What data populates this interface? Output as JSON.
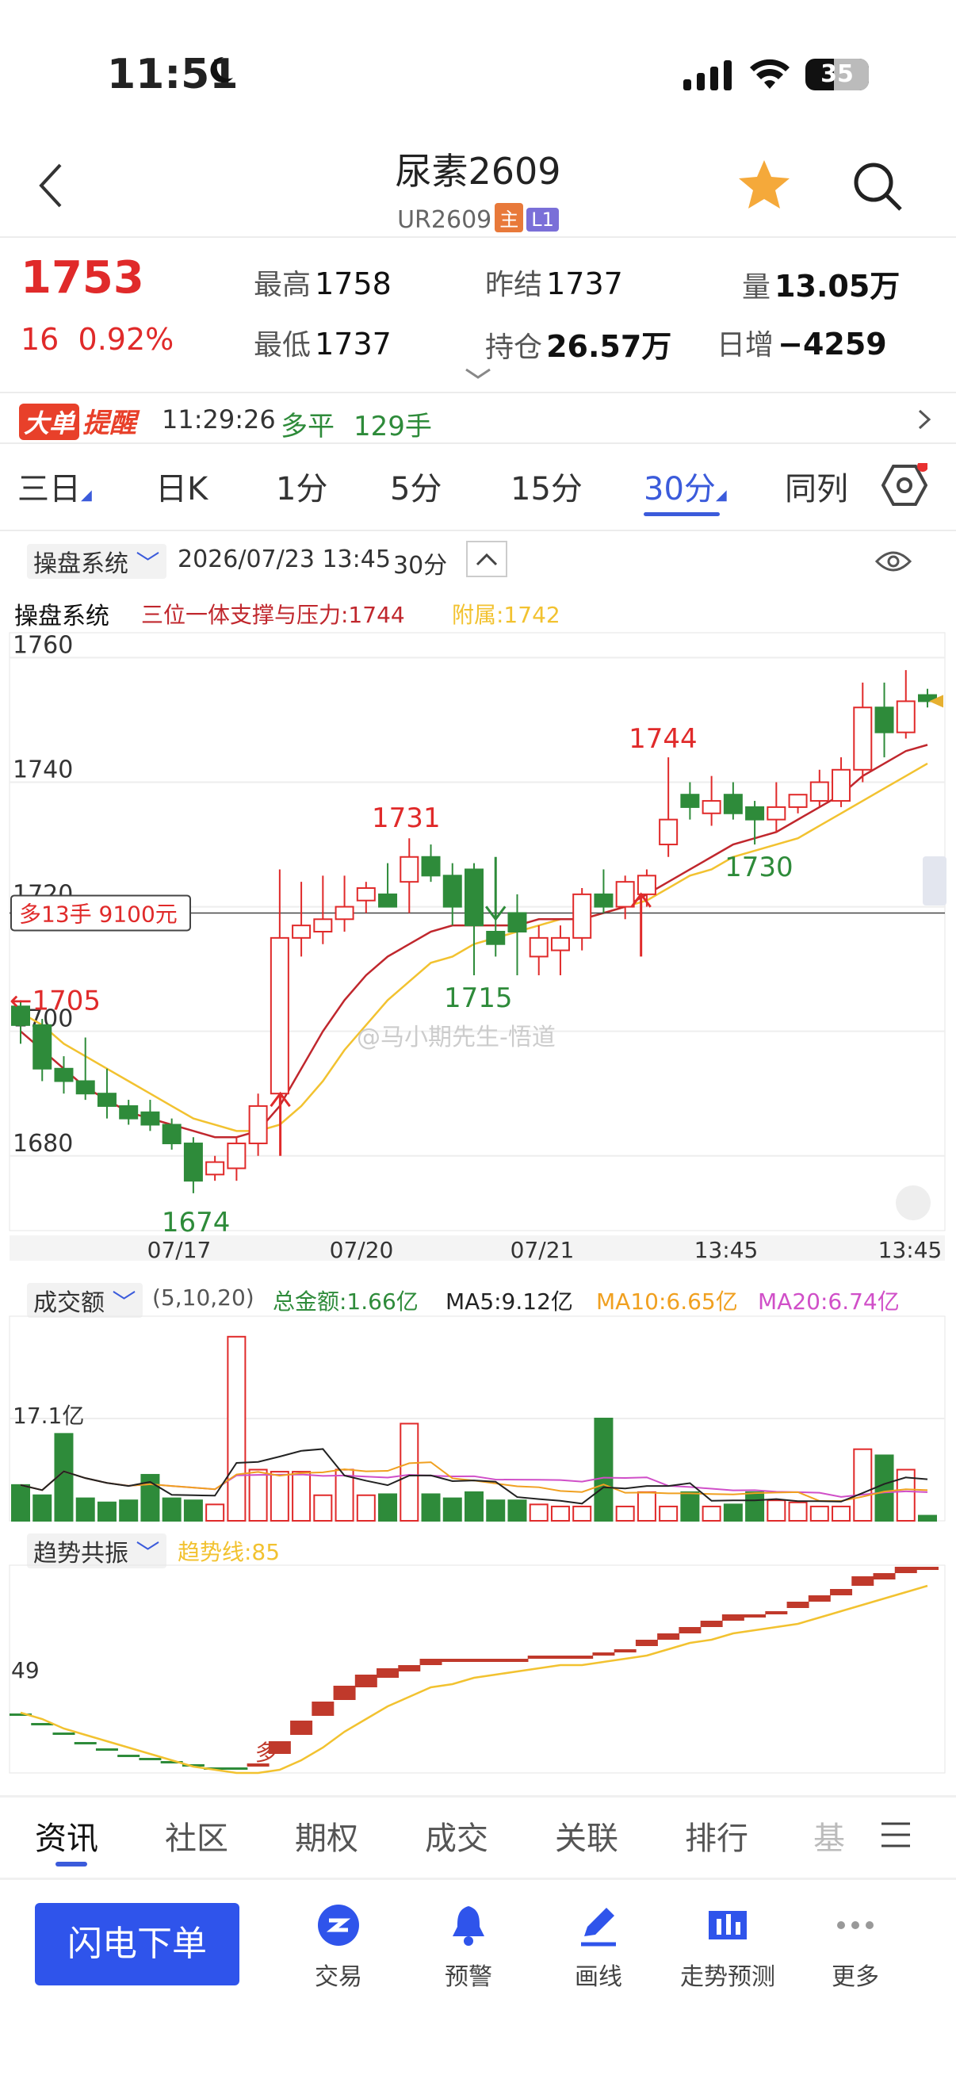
{
  "status_bar": {
    "time": "11:51",
    "battery": "35"
  },
  "header": {
    "title": "尿素2609",
    "code": "UR2609",
    "badge_main": "主",
    "badge_l1": "L1"
  },
  "quote": {
    "last": "1753",
    "change": "16",
    "change_pct": "0.92%",
    "high_label": "最高",
    "high": "1758",
    "low_label": "最低",
    "low": "1737",
    "prev_settle_label": "昨结",
    "prev_settle": "1737",
    "oi_label": "持仓",
    "oi": "26.57万",
    "vol_label": "量",
    "vol": "13.05万",
    "daily_inc_label": "日增",
    "daily_inc": "−4259"
  },
  "alert": {
    "tag1": "大单",
    "tag2": "提醒",
    "time": "11:29:26",
    "action": "多平",
    "qty": "129手"
  },
  "period_tabs": [
    "三日",
    "日K",
    "1分",
    "5分",
    "15分",
    "30分",
    "同列"
  ],
  "active_tab": "30分",
  "chart_header": {
    "system": "操盘系统",
    "datetime": "2026/07/23 13:45",
    "period": "30分"
  },
  "indicator": {
    "name": "操盘系统",
    "main": "三位一体支撑与压力:1744",
    "sub": "附属:1742"
  },
  "chart_data": {
    "type": "candlestick",
    "ylim": [
      1668,
      1764
    ],
    "yticks": [
      1760,
      1740,
      1720,
      1700,
      1680
    ],
    "xticks": [
      "07/17",
      "07/20",
      "07/21",
      "13:45",
      "13:45"
    ],
    "annotations": [
      "1674",
      "1731",
      "1715",
      "1744",
      "1730",
      "←1705"
    ],
    "hline_label": "多13手 9100元",
    "hline_value": 1719,
    "colors": {
      "up": "#e02a2a",
      "down": "#2e8b3a",
      "ma1": "#c0272d",
      "ma2": "#f2c230"
    },
    "candles": [
      [
        1704,
        1705,
        1698,
        1701
      ],
      [
        1701,
        1702,
        1692,
        1694
      ],
      [
        1694,
        1696,
        1690,
        1692
      ],
      [
        1692,
        1699,
        1689,
        1690
      ],
      [
        1690,
        1694,
        1686,
        1688
      ],
      [
        1688,
        1689,
        1685,
        1686
      ],
      [
        1687,
        1689,
        1684,
        1685
      ],
      [
        1685,
        1686,
        1681,
        1682
      ],
      [
        1682,
        1683,
        1674,
        1676
      ],
      [
        1677,
        1680,
        1676,
        1679
      ],
      [
        1678,
        1683,
        1676,
        1682
      ],
      [
        1682,
        1690,
        1680,
        1688
      ],
      [
        1690,
        1726,
        1688,
        1715
      ],
      [
        1715,
        1724,
        1712,
        1717
      ],
      [
        1716,
        1725,
        1714,
        1718
      ],
      [
        1718,
        1725,
        1716,
        1720
      ],
      [
        1721,
        1724,
        1719,
        1723
      ],
      [
        1722,
        1727,
        1720,
        1720
      ],
      [
        1724,
        1731,
        1719,
        1728
      ],
      [
        1728,
        1730,
        1724,
        1725
      ],
      [
        1725,
        1727,
        1717,
        1720
      ],
      [
        1726,
        1727,
        1709,
        1717
      ],
      [
        1716,
        1719,
        1712,
        1714
      ],
      [
        1719,
        1722,
        1709,
        1716
      ],
      [
        1712,
        1717,
        1709,
        1715
      ],
      [
        1713,
        1717,
        1709,
        1715
      ],
      [
        1715,
        1723,
        1713,
        1722
      ],
      [
        1722,
        1726,
        1719,
        1720
      ],
      [
        1720,
        1725,
        1718,
        1724
      ],
      [
        1722,
        1726,
        1720,
        1725
      ],
      [
        1730,
        1744,
        1728,
        1734
      ],
      [
        1738,
        1740,
        1734,
        1736
      ],
      [
        1735,
        1741,
        1733,
        1737
      ],
      [
        1738,
        1740,
        1734,
        1735
      ],
      [
        1736,
        1737,
        1730,
        1734
      ],
      [
        1734,
        1740,
        1732,
        1736
      ],
      [
        1736,
        1738,
        1735,
        1738
      ],
      [
        1737,
        1742,
        1736,
        1740
      ],
      [
        1737,
        1744,
        1736,
        1742
      ],
      [
        1742,
        1756,
        1740,
        1752
      ],
      [
        1752,
        1756,
        1744,
        1748
      ],
      [
        1748,
        1758,
        1747,
        1753
      ],
      [
        1754,
        1755,
        1752,
        1753
      ]
    ],
    "ma1": [
      1700,
      1697,
      1694,
      1691,
      1689,
      1687,
      1686,
      1685,
      1684,
      1683,
      1683,
      1684,
      1688,
      1694,
      1700,
      1705,
      1709,
      1712,
      1714,
      1716,
      1717,
      1717,
      1717,
      1717,
      1718,
      1718,
      1718,
      1719,
      1720,
      1722,
      1724,
      1726,
      1728,
      1730,
      1731,
      1732,
      1734,
      1736,
      1738,
      1741,
      1743,
      1745,
      1746
    ],
    "ma2": [
      1703,
      1701,
      1698,
      1696,
      1694,
      1692,
      1690,
      1688,
      1686,
      1685,
      1684,
      1684,
      1685,
      1688,
      1692,
      1697,
      1701,
      1705,
      1708,
      1711,
      1712,
      1714,
      1715,
      1716,
      1717,
      1718,
      1718,
      1719,
      1720,
      1721,
      1723,
      1725,
      1726,
      1728,
      1729,
      1730,
      1731,
      1733,
      1735,
      1737,
      1739,
      1741,
      1743
    ]
  },
  "volume": {
    "label": "成交额",
    "params": "(5,10,20)",
    "total": "总金额:1.66亿",
    "ma5": "MA5:9.12亿",
    "ma10": "MA10:6.65亿",
    "ma20": "MA20:6.74亿",
    "ytick": "17.1亿",
    "bars": [
      0.35,
      0.25,
      0.85,
      0.22,
      0.18,
      0.2,
      0.45,
      0.22,
      0.2,
      0.16,
      1.8,
      0.5,
      0.48,
      0.48,
      0.25,
      0.5,
      0.25,
      0.26,
      0.95,
      0.26,
      0.22,
      0.28,
      0.2,
      0.2,
      0.16,
      0.14,
      0.14,
      1.0,
      0.14,
      0.28,
      0.14,
      0.28,
      0.14,
      0.16,
      0.28,
      0.2,
      0.18,
      0.14,
      0.14,
      0.7,
      0.64,
      0.5,
      0.05
    ],
    "colors": {
      "up": "#e02a2a",
      "down": "#2e8b3a",
      "ma5": "#222222",
      "ma10": "#f0a020",
      "ma20": "#d04fc8"
    }
  },
  "trend": {
    "label": "趋势共振",
    "line": "趋势线:85",
    "ytick": "49",
    "marker": "多"
  },
  "watermark": "@马小期先生-悟道",
  "bottom_tabs": [
    "资讯",
    "社区",
    "期权",
    "成交",
    "关联",
    "排行",
    "基"
  ],
  "bottom_nav": {
    "primary": "闪电下单",
    "items": [
      "交易",
      "预警",
      "画线",
      "走势预测",
      "更多"
    ]
  }
}
